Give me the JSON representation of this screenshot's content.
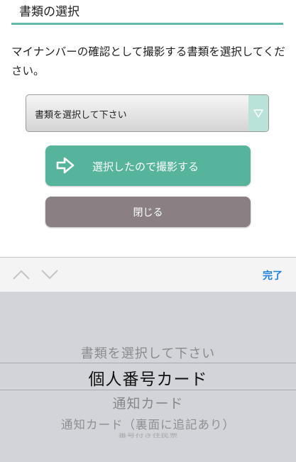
{
  "header": {
    "title": "書類の選択"
  },
  "main": {
    "instruction": "マイナンバーの確認として撮影する書類を選択してください。",
    "select": {
      "value": "書類を選択して下さい",
      "arrow_icon": "triangle-down-icon"
    },
    "capture_button": {
      "label": "選択したので撮影する",
      "icon": "arrow-right-icon"
    },
    "close_button": {
      "label": "閉じる"
    }
  },
  "toolbar": {
    "prev_icon": "chevron-up-icon",
    "next_icon": "chevron-down-icon",
    "done_label": "完了"
  },
  "picker": {
    "options": [
      "書類を選択して下さい",
      "個人番号カード",
      "通知カード",
      "通知カード（裏面に追記あり）",
      "番号付き住民票"
    ],
    "selected": "個人番号カード"
  },
  "colors": {
    "accent": "#56b49c",
    "header_underline": "#5fb8a8",
    "close_button": "#8a8084",
    "done_link": "#1a7fe0",
    "picker_background": "#d2d4d9"
  }
}
